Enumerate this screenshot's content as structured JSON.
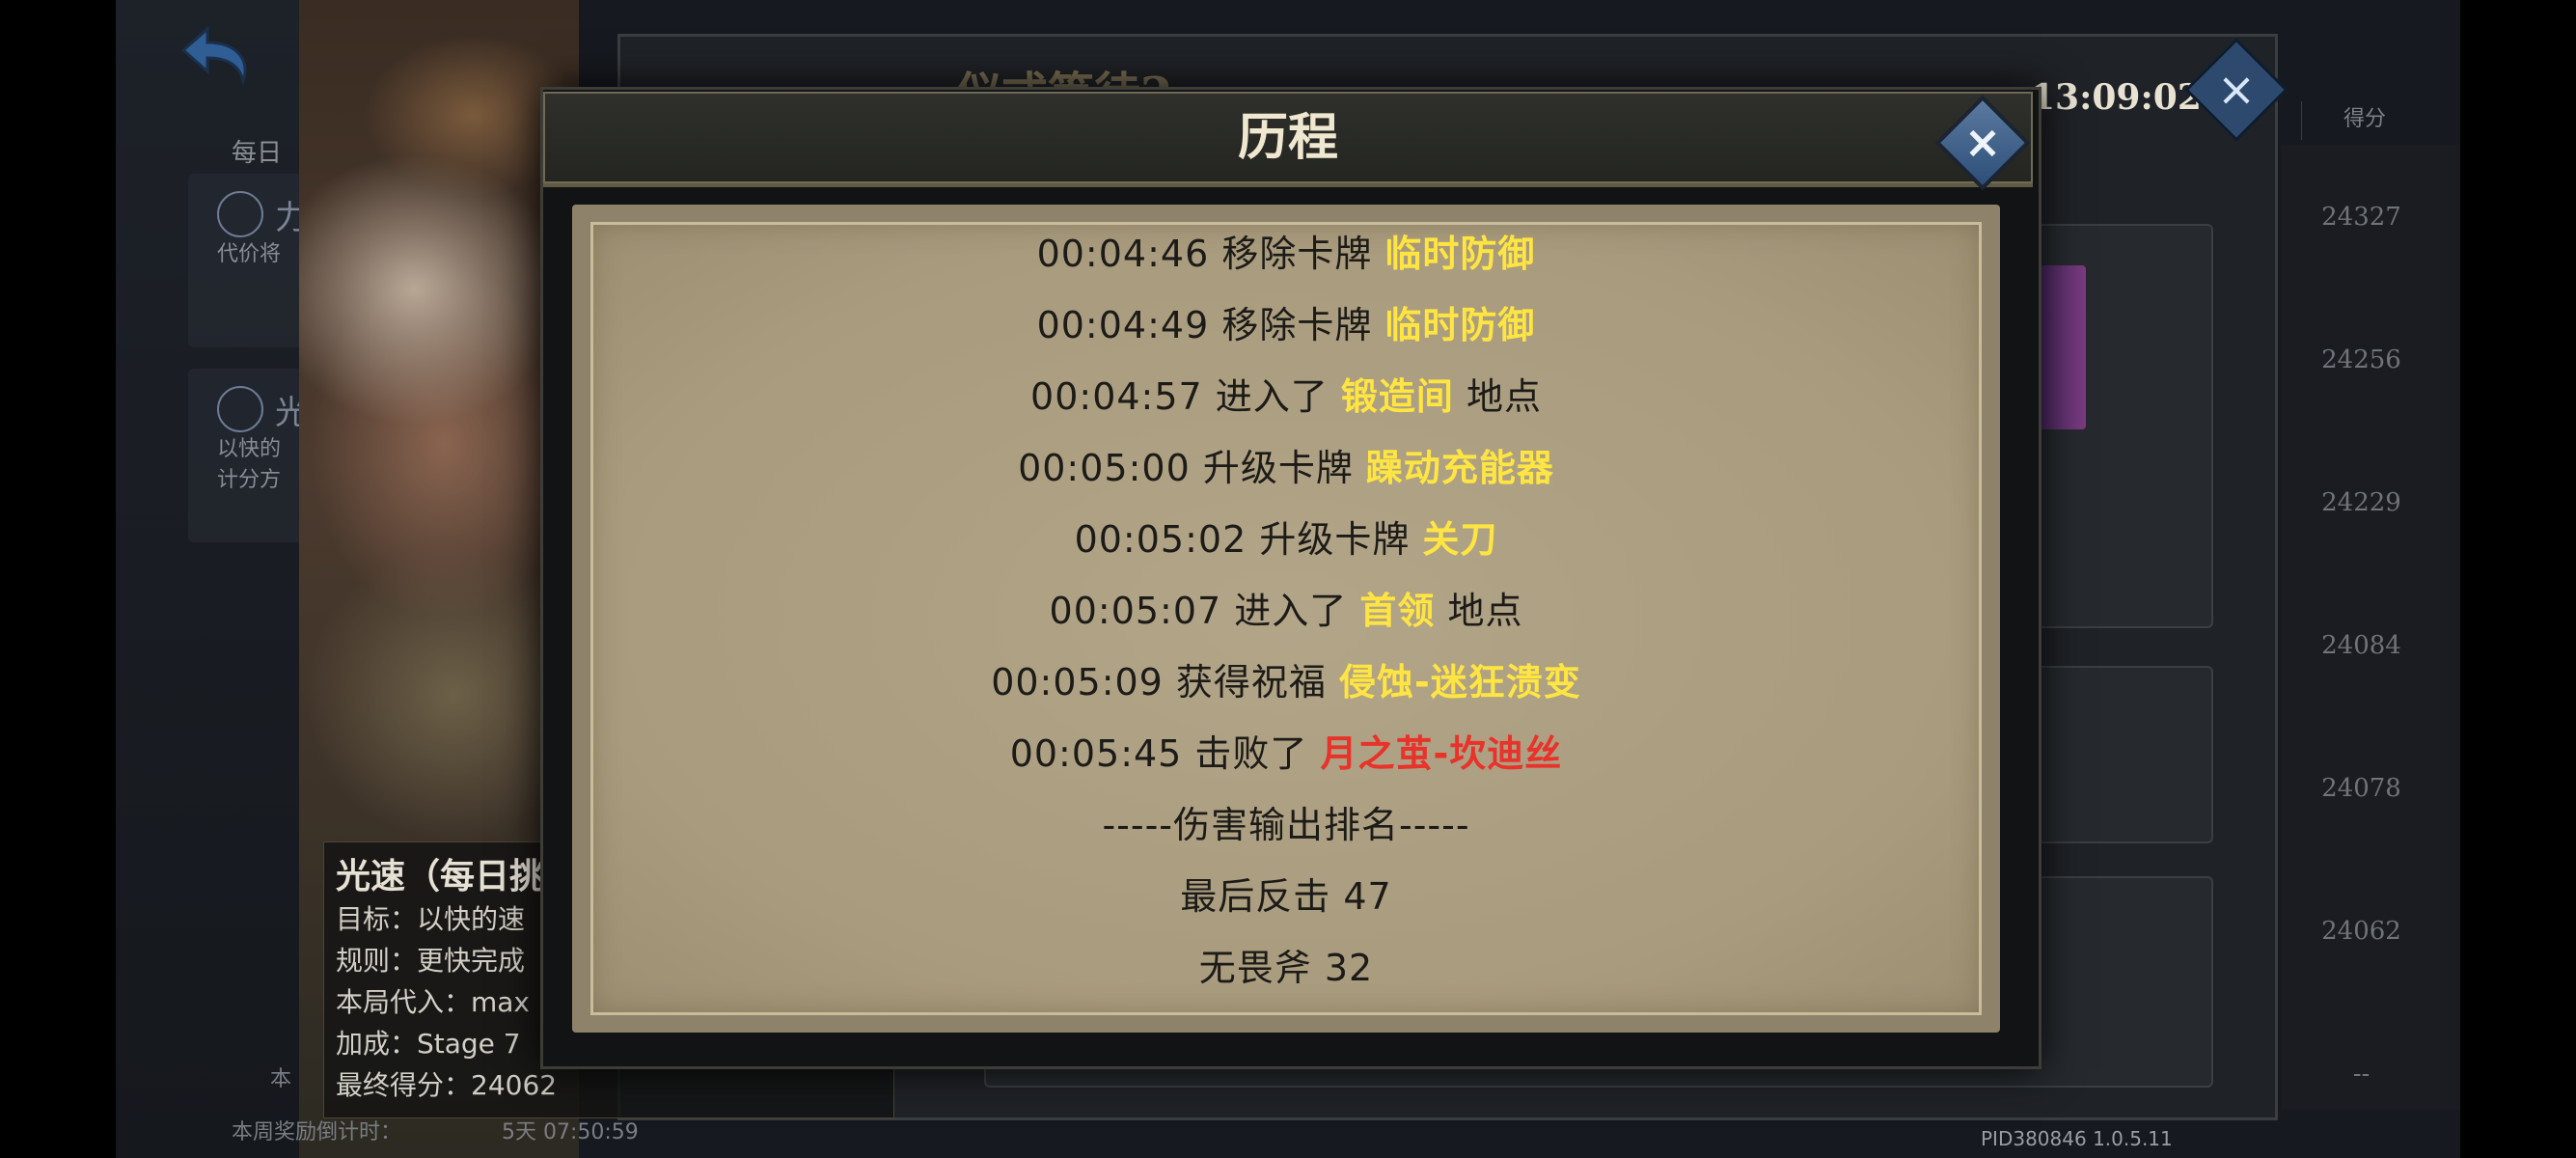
{
  "background": {
    "daily_label": "每日",
    "mode_cards": [
      {
        "title": "力",
        "line1": "代价将",
        "line2": ""
      },
      {
        "title": "光",
        "line1": "以快的",
        "line2": "计分方"
      }
    ],
    "rules": {
      "title": "光速（每日挑",
      "lines": [
        "目标：以快的速",
        "规则：更快完成",
        "本局代入：max",
        "加成：Stage 7",
        "最终得分：24062"
      ]
    },
    "ben_label": "本",
    "weekly_label": "本周奖励倒计时：",
    "weekly_timer": "5天 07:50:59",
    "title_bar": "仪式等待2",
    "timer": "13:09:02",
    "close_icon": "×",
    "score_header": "得分",
    "scores": [
      "24327",
      "24256",
      "24229",
      "24084",
      "24078",
      "24062",
      "--"
    ],
    "pid": "PID380846  1.0.5.11"
  },
  "modal": {
    "title": "历程",
    "close_icon": "×",
    "lines": [
      {
        "pre": "00:04:46 移除卡牌 ",
        "hl": "临时防御",
        "post": "",
        "color": "yellow"
      },
      {
        "pre": "00:04:49 移除卡牌 ",
        "hl": "临时防御",
        "post": "",
        "color": "yellow"
      },
      {
        "pre": "00:04:57 进入了 ",
        "hl": "锻造间",
        "post": " 地点",
        "color": "yellow"
      },
      {
        "pre": "00:05:00 升级卡牌 ",
        "hl": "躁动充能器",
        "post": "",
        "color": "yellow"
      },
      {
        "pre": "00:05:02 升级卡牌 ",
        "hl": "关刀",
        "post": "",
        "color": "yellow"
      },
      {
        "pre": "00:05:07 进入了 ",
        "hl": "首领",
        "post": " 地点",
        "color": "yellow"
      },
      {
        "pre": "00:05:09 获得祝福 ",
        "hl": "侵蚀-迷狂溃变",
        "post": "",
        "color": "yellow"
      },
      {
        "pre": "00:05:45 击败了 ",
        "hl": "月之茧-坎迪丝",
        "post": "",
        "color": "red"
      },
      {
        "pre": "-----伤害输出排名-----",
        "hl": "",
        "post": "",
        "color": "none"
      },
      {
        "pre": "最后反击  47",
        "hl": "",
        "post": "",
        "color": "none"
      },
      {
        "pre": "无畏斧  32",
        "hl": "",
        "post": "",
        "color": "none"
      }
    ]
  },
  "colors": {
    "highlight_yellow": "#ffe541",
    "highlight_red": "#e8322a",
    "parchment": "#b2a588"
  }
}
